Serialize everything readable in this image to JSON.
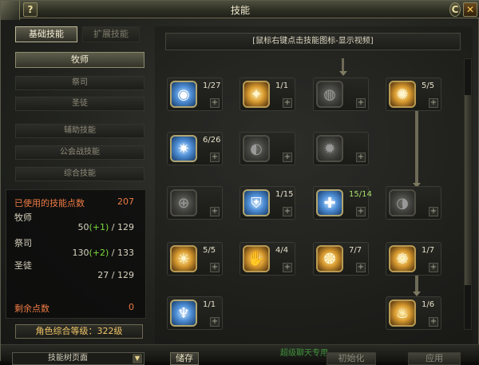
{
  "window": {
    "title": "技能",
    "help_label": "?",
    "close_label": "✕",
    "min_label": "C"
  },
  "tabs": [
    {
      "label": "基础技能",
      "active": true
    },
    {
      "label": "扩展技能",
      "active": false
    }
  ],
  "categories": [
    {
      "label": "牧师",
      "active": true
    },
    {
      "label": "祭司",
      "active": false
    },
    {
      "label": "圣徒",
      "active": false
    },
    {
      "label": "辅助技能",
      "active": false
    },
    {
      "label": "公会战技能",
      "active": false
    },
    {
      "label": "综合技能",
      "active": false
    }
  ],
  "points": {
    "used_label": "已使用的技能点数",
    "used_value": "207",
    "priest_label": "牧师",
    "priest_value": "50",
    "priest_bonus": "(+1)",
    "priest_max": " / 129",
    "hierophant_label": "祭司",
    "hierophant_value": "130",
    "hierophant_bonus": "(+2)",
    "hierophant_max": " / 133",
    "saint_label": "圣徒",
    "saint_value": "27 / 129",
    "remaining_label": "剩余点数",
    "remaining_value": "0",
    "colors": {
      "label_red": "#ee7b44",
      "bonus_green": "#7bdb3c"
    }
  },
  "level_bar": "角色综合等级：322级",
  "hint": "[鼠标右键点击技能图标-显示视频]",
  "skills": [
    {
      "level": "1/27",
      "style": "blue",
      "icon": "circle-eye-icon",
      "glyph": "◉"
    },
    {
      "level": "1/1",
      "style": "gold",
      "icon": "holy-figure-icon",
      "glyph": "✦"
    },
    {
      "level": "",
      "style": "grey",
      "icon": "locked-orb-icon",
      "glyph": "◍"
    },
    {
      "level": "5/5",
      "style": "gold",
      "icon": "sun-cross-icon",
      "glyph": "✺"
    },
    {
      "level": "6/26",
      "style": "blue",
      "icon": "lightning-burst-icon",
      "glyph": "✷"
    },
    {
      "level": "",
      "style": "grey",
      "icon": "locked-fist-icon",
      "glyph": "◐"
    },
    {
      "level": "",
      "style": "grey",
      "icon": "locked-burst-icon",
      "glyph": "✹"
    },
    {
      "level": "",
      "style": "grey",
      "icon": "locked-ring-icon",
      "glyph": "⊕"
    },
    {
      "level": "1/15",
      "style": "blue",
      "icon": "shield-icon",
      "glyph": "⛨"
    },
    {
      "level": "15/14",
      "style": "blue",
      "icon": "holy-cross-icon",
      "glyph": "✚",
      "green": true
    },
    {
      "level": "",
      "style": "grey",
      "icon": "locked-slash-icon",
      "glyph": "◑"
    },
    {
      "level": "5/5",
      "style": "gold",
      "icon": "light-wave-icon",
      "glyph": "☀"
    },
    {
      "level": "4/4",
      "style": "gold",
      "icon": "raise-hand-icon",
      "glyph": "✋"
    },
    {
      "level": "7/7",
      "style": "gold",
      "icon": "radiant-burst-icon",
      "glyph": "❂"
    },
    {
      "level": "1/7",
      "style": "gold",
      "icon": "golden-halo-icon",
      "glyph": "❁"
    },
    {
      "level": "1/1",
      "style": "blue",
      "icon": "angel-wings-icon",
      "glyph": "♆"
    },
    {
      "level": "1/6",
      "style": "gold",
      "icon": "divine-flame-icon",
      "glyph": "♨"
    }
  ],
  "bottom": {
    "dropdown_label": "技能树页面",
    "save_label": "储存",
    "reset_label": "初始化",
    "apply_label": "应用",
    "green_text": "超级聊天专用"
  }
}
